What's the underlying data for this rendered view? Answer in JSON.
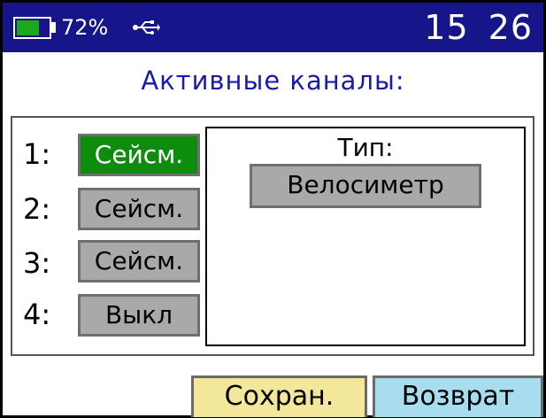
{
  "status_bar": {
    "battery_percent_text": "72%",
    "battery_level": 0.72,
    "usb_icon": "usb-icon",
    "time_hours": "15",
    "time_minutes": "26",
    "bg_color": "#16168a",
    "battery_color": "#1ca81c"
  },
  "title": "Активные каналы:",
  "channels": [
    {
      "number": "1:",
      "value": "Сейсм.",
      "active": true
    },
    {
      "number": "2:",
      "value": "Сейсм.",
      "active": false
    },
    {
      "number": "3:",
      "value": "Сейсм.",
      "active": false
    },
    {
      "number": "4:",
      "value": "Выкл",
      "active": false
    }
  ],
  "type_panel": {
    "label": "Тип:",
    "value": "Велосиметр"
  },
  "buttons": {
    "save_label": "Сохран.",
    "back_label": "Возврат"
  },
  "colors": {
    "title": "#1a1ab0",
    "active_channel": "#0e8c0e",
    "inactive_channel": "#a9a9a9",
    "save_button": "#f2e79a",
    "back_button": "#a8dcef"
  }
}
